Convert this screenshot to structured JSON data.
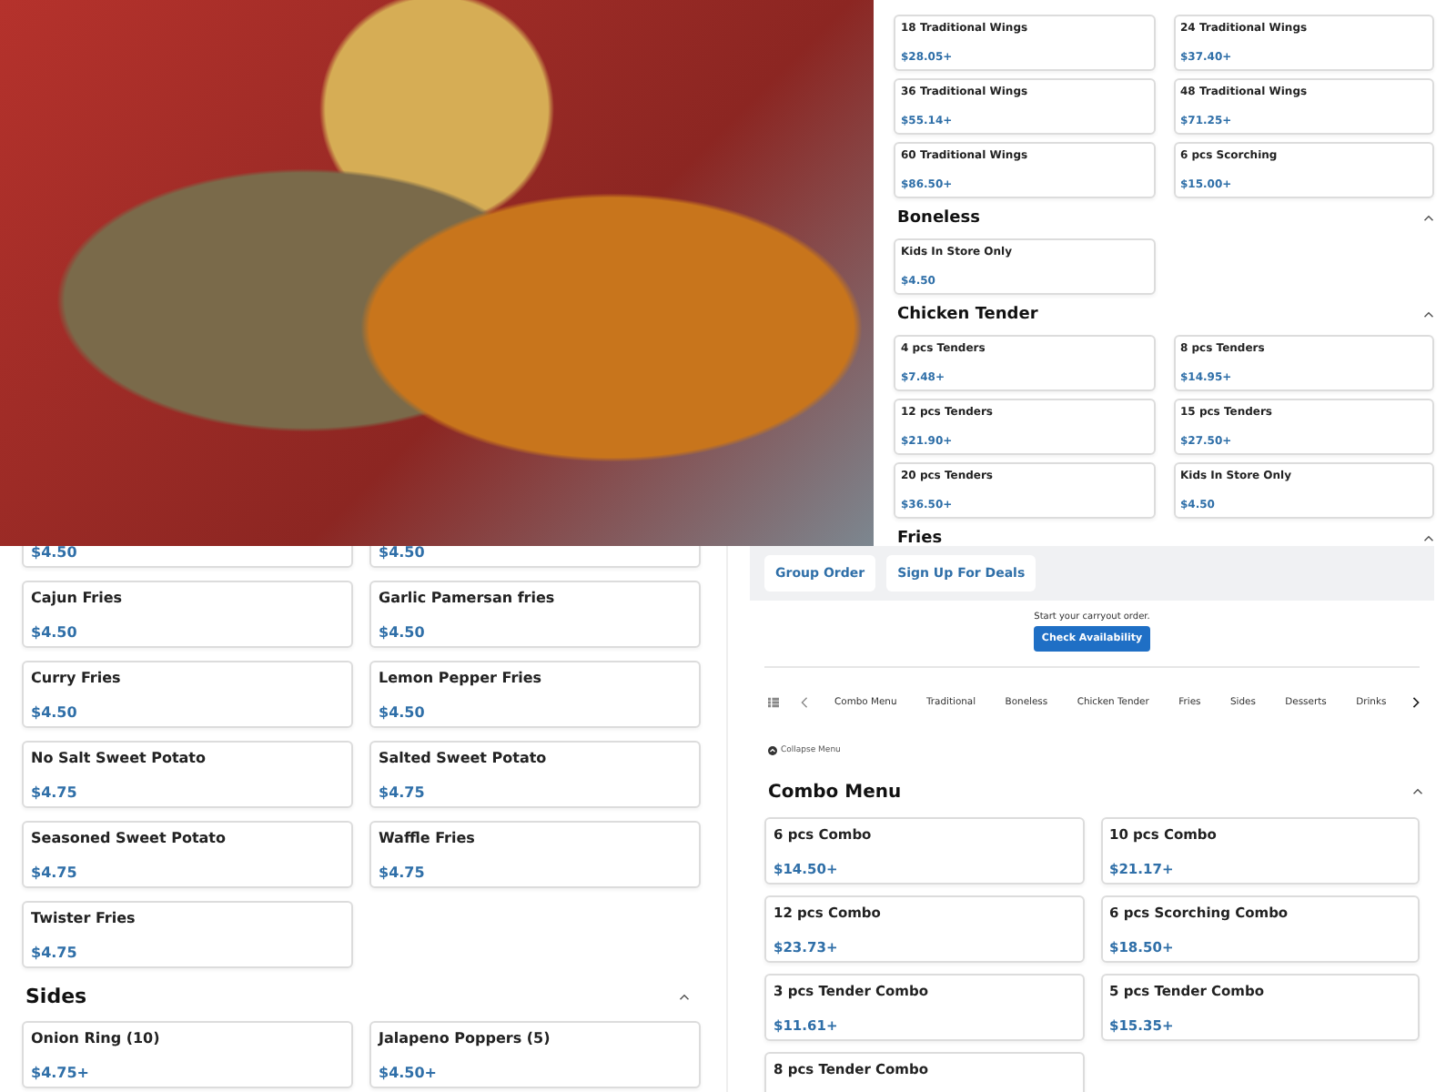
{
  "wings_panel": {
    "items": [
      {
        "name": "18 Traditional Wings",
        "price": "$28.05+"
      },
      {
        "name": "24 Traditional Wings",
        "price": "$37.40+"
      },
      {
        "name": "36 Traditional Wings",
        "price": "$55.14+"
      },
      {
        "name": "48 Traditional Wings",
        "price": "$71.25+"
      },
      {
        "name": "60 Traditional Wings",
        "price": "$86.50+"
      },
      {
        "name": "6 pcs Scorching",
        "price": "$15.00+"
      }
    ],
    "sections": [
      {
        "title": "Boneless",
        "expanded": true,
        "items": [
          {
            "name": "Kids In Store Only",
            "price": "$4.50"
          }
        ]
      },
      {
        "title": "Chicken Tender",
        "expanded": true,
        "items": [
          {
            "name": "4 pcs Tenders",
            "price": "$7.48+"
          },
          {
            "name": "8 pcs Tenders",
            "price": "$14.95+"
          },
          {
            "name": "12 pcs Tenders",
            "price": "$21.90+"
          },
          {
            "name": "15 pcs Tenders",
            "price": "$27.50+"
          },
          {
            "name": "20 pcs Tenders",
            "price": "$36.50+"
          },
          {
            "name": "Kids In Store Only",
            "price": "$4.50"
          }
        ]
      },
      {
        "title": "Fries",
        "expanded": true
      }
    ]
  },
  "fries_panel": {
    "items": [
      {
        "price": "$4.50"
      },
      {
        "price": "$4.50"
      },
      {
        "name": "Cajun Fries",
        "price": "$4.50"
      },
      {
        "name": "Garlic Pamersan fries",
        "price": "$4.50"
      },
      {
        "name": "Curry Fries",
        "price": "$4.50"
      },
      {
        "name": "Lemon Pepper Fries",
        "price": "$4.50"
      },
      {
        "name": "No Salt Sweet Potato",
        "price": "$4.75"
      },
      {
        "name": "Salted Sweet Potato",
        "price": "$4.75"
      },
      {
        "name": "Seasoned Sweet Potato",
        "price": "$4.75"
      },
      {
        "name": "Waffle Fries",
        "price": "$4.75"
      },
      {
        "name": "Twister Fries",
        "price": "$4.75"
      }
    ],
    "sections": [
      {
        "title": "Sides",
        "expanded": true,
        "items": [
          {
            "name": "Onion Ring (10)",
            "price": "$4.75+"
          },
          {
            "name": "Jalapeno Poppers (5)",
            "price": "$4.50+"
          }
        ]
      }
    ]
  },
  "order_panel": {
    "buttons": [
      "Group Order",
      "Sign Up For Deals"
    ],
    "carryout_text": "Start your carryout order.",
    "check_button": "Check Availability",
    "categories": [
      {
        "label": "Combo Menu",
        "selected": false
      },
      {
        "label": "Traditional",
        "selected": false
      },
      {
        "label": "Boneless",
        "selected": false
      },
      {
        "label": "Chicken Tender",
        "selected": false
      },
      {
        "label": "Fries",
        "selected": false
      },
      {
        "label": "Sides",
        "selected": false
      },
      {
        "label": "Desserts",
        "selected": false
      },
      {
        "label": "Drinks",
        "selected": false
      }
    ],
    "collapse_link": "Collapse Menu",
    "section": {
      "title": "Combo Menu",
      "expanded": true,
      "items": [
        {
          "name": "6 pcs Combo",
          "price": "$14.50+"
        },
        {
          "name": "10 pcs Combo",
          "price": "$21.17+"
        },
        {
          "name": "12 pcs Combo",
          "price": "$23.73+"
        },
        {
          "name": "6 pcs Scorching Combo",
          "price": "$18.50+"
        },
        {
          "name": "3 pcs Tender Combo",
          "price": "$11.61+"
        },
        {
          "name": "5 pcs Tender Combo",
          "price": "$15.35+"
        },
        {
          "name": "8 pcs Tender Combo"
        }
      ]
    }
  }
}
